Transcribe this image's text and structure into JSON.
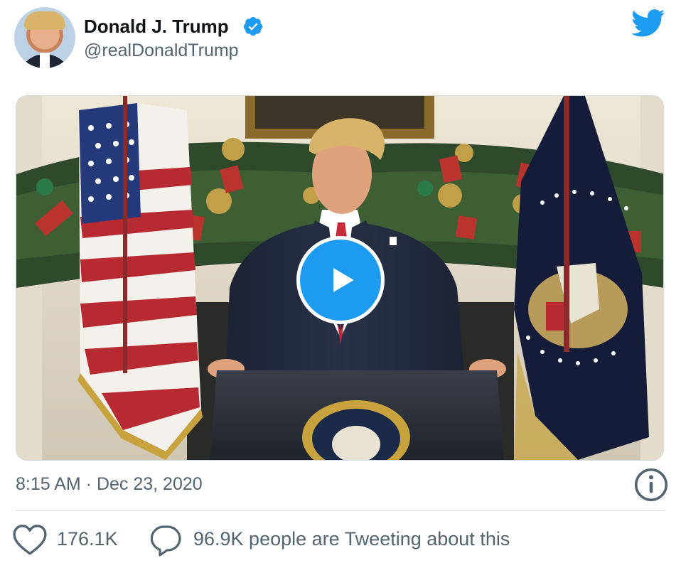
{
  "author": {
    "name": "Donald J. Trump",
    "handle": "@realDonaldTrump",
    "verified_icon": "verified-badge-icon",
    "avatar_icon": "avatar"
  },
  "brand": {
    "icon": "twitter-bird-icon",
    "color": "#1d9bf0"
  },
  "media": {
    "type": "video",
    "play_icon": "play-icon"
  },
  "meta": {
    "time": "8:15 AM",
    "separator": " · ",
    "date": "Dec 23, 2020",
    "info_icon": "info-icon"
  },
  "actions": {
    "like_icon": "heart-icon",
    "like_count": "176.1K",
    "reply_icon": "speech-bubble-icon",
    "reply_text": "96.9K people are Tweeting about this"
  },
  "colors": {
    "secondary_text": "#536471",
    "divider": "#cfd9de",
    "accent": "#1d9bf0"
  }
}
